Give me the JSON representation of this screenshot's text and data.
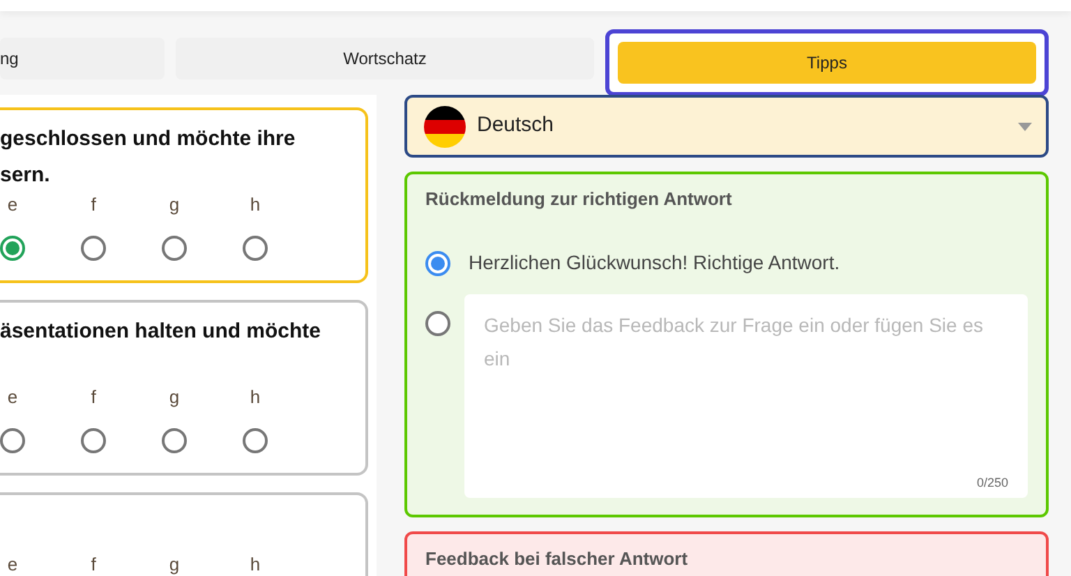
{
  "tabs": [
    {
      "label": "ng",
      "selected": false
    },
    {
      "label": "Wortschatz",
      "selected": false
    },
    {
      "label": "Tipps",
      "selected": true
    }
  ],
  "questions": [
    {
      "lines": [
        "geschlossen und möchte ihre",
        "sern."
      ],
      "active": true,
      "options": [
        {
          "label": "e",
          "selected": true
        },
        {
          "label": "f",
          "selected": false
        },
        {
          "label": "g",
          "selected": false
        },
        {
          "label": "h",
          "selected": false
        }
      ]
    },
    {
      "lines": [
        "äsentationen halten und möchte"
      ],
      "active": false,
      "options": [
        {
          "label": "e",
          "selected": false
        },
        {
          "label": "f",
          "selected": false
        },
        {
          "label": "g",
          "selected": false
        },
        {
          "label": "h",
          "selected": false
        }
      ]
    },
    {
      "active": false,
      "options": [
        {
          "label": "e"
        },
        {
          "label": "f"
        },
        {
          "label": "g"
        },
        {
          "label": "h"
        }
      ]
    }
  ],
  "language": {
    "label": "Deutsch"
  },
  "feedback_sections": [
    {
      "kind": "correct",
      "title": "Rückmeldung zur richtigen Antwort",
      "options": [
        {
          "kind": "preset",
          "text": "Herzlichen Glückwunsch! Richtige Antwort.",
          "selected": true
        },
        {
          "kind": "custom",
          "placeholder": "Geben Sie das Feedback zur Frage ein oder fügen Sie es ein",
          "counter": "0/250",
          "selected": false
        }
      ]
    },
    {
      "kind": "incorrect",
      "title": "Feedback bei falscher Antwort"
    }
  ]
}
